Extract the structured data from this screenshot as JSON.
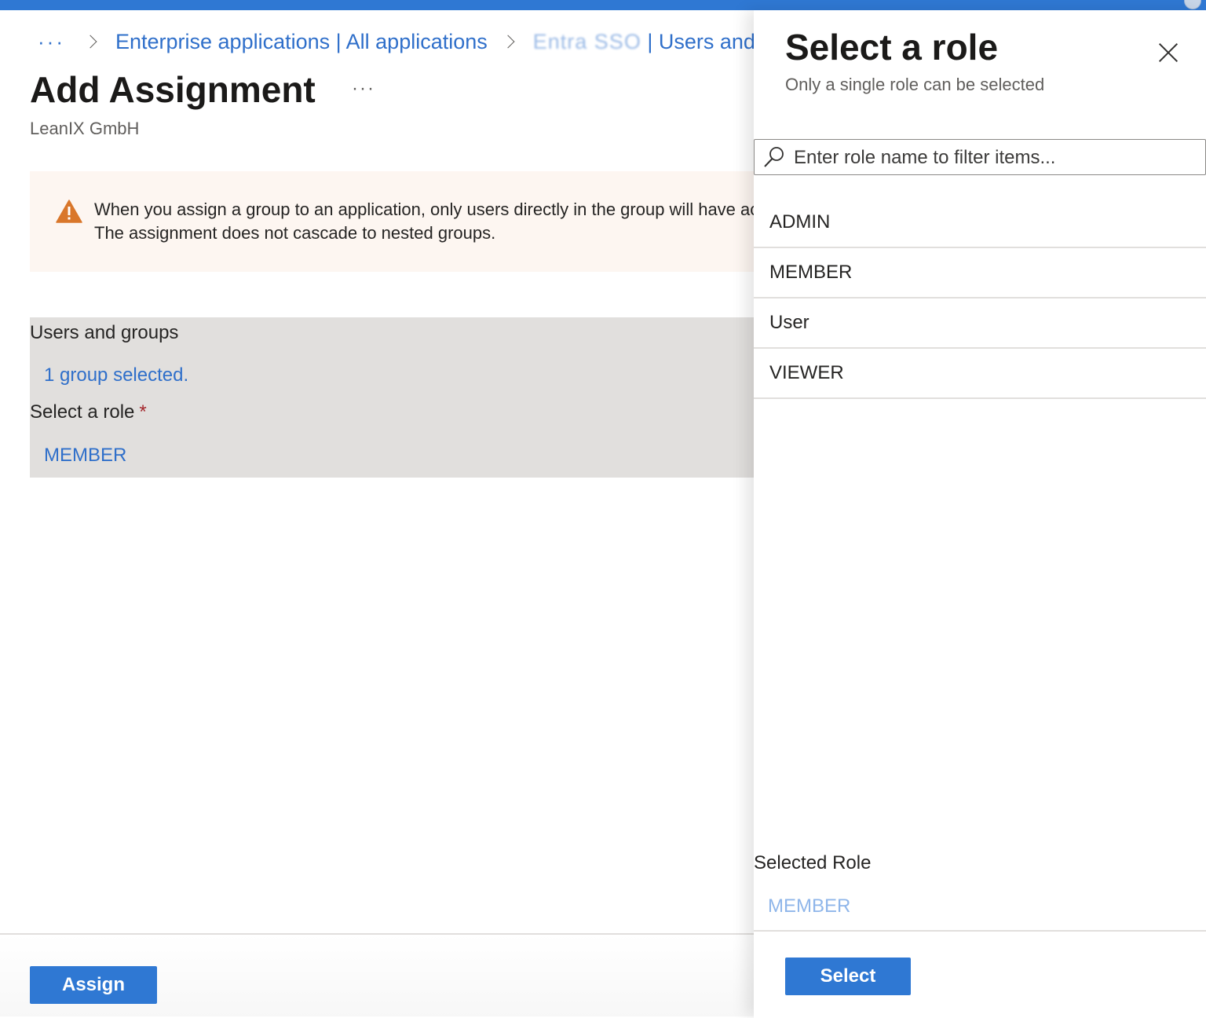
{
  "breadcrumb": {
    "ellipsis": "···",
    "items": [
      {
        "label": "Enterprise applications | All applications"
      },
      {
        "label": "Entra SSO | Users and groups",
        "obscured_part": "Entra SSO",
        "visible_part": " | Users and g"
      }
    ]
  },
  "page": {
    "title": "Add Assignment",
    "more": "···",
    "subtitle": "LeanIX GmbH"
  },
  "warning": {
    "text": "When you assign a group to an application, only users directly in the group will have access. The assignment does not cascade to nested groups."
  },
  "assignment": {
    "users_label": "Users and groups",
    "users_value": "1 group selected.",
    "role_label": "Select a role",
    "required_mark": "*",
    "role_value": "MEMBER"
  },
  "footer": {
    "assign_label": "Assign"
  },
  "panel": {
    "title": "Select a role",
    "subtitle": "Only a single role can be selected",
    "search_placeholder": "Enter role name to filter items...",
    "roles": [
      "ADMIN",
      "MEMBER",
      "User",
      "VIEWER"
    ],
    "selected_role_label": "Selected Role",
    "selected_role_value": "MEMBER",
    "select_label": "Select"
  },
  "colors": {
    "accent": "#2f78d3",
    "link": "#2f6fca",
    "warning_bg": "#fdf6f1",
    "warning_icon": "#d9772b",
    "selection_bg": "#e1dfdd"
  }
}
